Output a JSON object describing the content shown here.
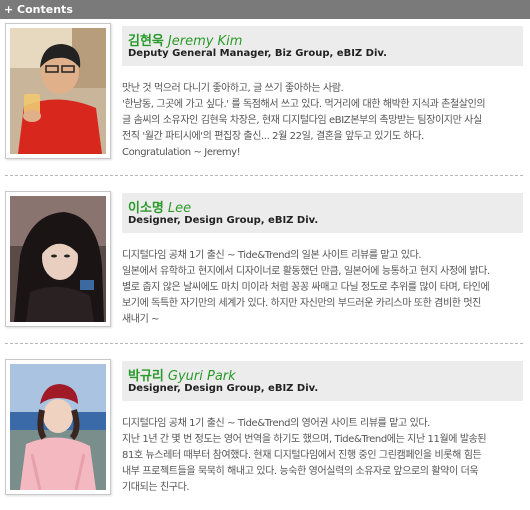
{
  "header": {
    "title": "+ Contents"
  },
  "profiles": [
    {
      "name_ko": "김현욱",
      "name_en": "Jeremy Kim",
      "role": "Deputy General Manager, Biz Group, eBIZ Div.",
      "desc": [
        "맛난 것 먹으러 다니기 좋아하고, 글 쓰기 좋아하는 사람.",
        "'한남동, 그곳에 가고 싶다.' 를 독점해서 쓰고 있다. 먹거리에 대한 해박한 지식과 촌철살인의",
        "글 솜씨의 소유자인 김현욱 차장은, 현재 디지털다임 eBIZ본부의 촉망받는 팀장이지만 사실",
        "전직 '월간 파티시에'의 편집장 출신... 2월 22일, 결혼을 앞두고 있기도 하다.",
        "Congratulation ~ Jeremy!"
      ]
    },
    {
      "name_ko": "이소명",
      "name_en": "Lee",
      "role": "Designer, Design Group, eBIZ Div.",
      "desc": [
        "디지털다임 공채 1기 출신 ~  Tide&Trend의 일본 사이트 리뷰를 맡고 있다.",
        "일본에서 유학하고 현지에서 디자이너로 활동했던 만큼, 일본어에 능통하고 현지 사정에 밝다.",
        "별로 춥지 않은 날씨에도 마치 미이라 처럼 꽁꽁 싸매고 다닐 정도로 추위를 많이 타며, 타인에",
        "보기에 독특한 자기만의 세계가 있다. 하지만 자신만의 부드러운 카리스마 또한 겸비한 멋진",
        "새내기 ~"
      ]
    },
    {
      "name_ko": "박규리",
      "name_en": "Gyuri Park",
      "role": "Designer, Design Group, eBIZ Div.",
      "desc": [
        "디지털다임 공채 1기 출신 ~  Tide&Trend의 영어권 사이트 리뷰를 맡고 있다.",
        "지난 1년 간 몇 번 정도는 영어 번역을 하기도 했으며, Tide&Trend에는 지난 11월에 발송된",
        "81호 뉴스레터 때부터 참여했다. 현재 디지털다임에서 진행 중인 그린캠페인을 비롯해 힘든",
        "내부 프로젝트들을 묵묵히 해내고 있다. 능숙한 영어실력의 소유자로 앞으로의 활약이 더욱",
        "기대되는 친구다."
      ]
    }
  ]
}
